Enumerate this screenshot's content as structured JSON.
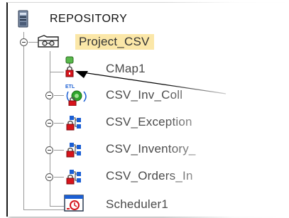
{
  "tree": {
    "root": {
      "label": "REPOSITORY",
      "icon": "repository-server-icon"
    },
    "project": {
      "label": "Project_CSV",
      "icon": "project-folder-icon",
      "highlight": "#fbe7a8"
    },
    "items": [
      {
        "label": "CMap1",
        "icon": "locked-cmap-icon",
        "expandable": false
      },
      {
        "label": "CSV_Inv_Coll",
        "icon": "locked-etl-process-icon",
        "expandable": true
      },
      {
        "label": "CSV_Exception",
        "icon": "locked-collaboration-icon",
        "expandable": true
      },
      {
        "label": "CSV_Inventory_",
        "icon": "locked-collaboration-icon",
        "expandable": true
      },
      {
        "label": "CSV_Orders_In",
        "icon": "locked-collaboration-icon",
        "expandable": true
      },
      {
        "label": "Scheduler1",
        "icon": "scheduler-icon",
        "expandable": false
      }
    ]
  },
  "colors": {
    "lock": "#d8131b",
    "connector": "#9a9a9a",
    "flow_blue": "#1b5fd4",
    "flow_red": "#d4141b"
  }
}
